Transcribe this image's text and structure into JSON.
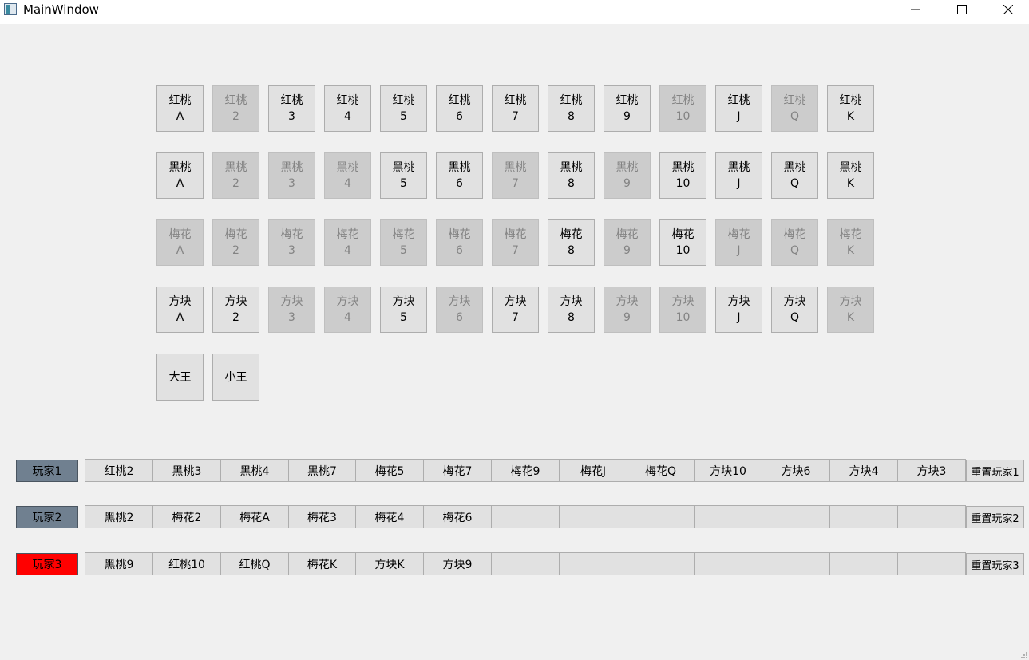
{
  "window": {
    "title": "MainWindow"
  },
  "deck": {
    "rows": [
      {
        "suit": "红桃",
        "cards": [
          {
            "rank": "A",
            "disabled": false
          },
          {
            "rank": "2",
            "disabled": true
          },
          {
            "rank": "3",
            "disabled": false
          },
          {
            "rank": "4",
            "disabled": false
          },
          {
            "rank": "5",
            "disabled": false
          },
          {
            "rank": "6",
            "disabled": false
          },
          {
            "rank": "7",
            "disabled": false
          },
          {
            "rank": "8",
            "disabled": false
          },
          {
            "rank": "9",
            "disabled": false
          },
          {
            "rank": "10",
            "disabled": true
          },
          {
            "rank": "J",
            "disabled": false
          },
          {
            "rank": "Q",
            "disabled": true
          },
          {
            "rank": "K",
            "disabled": false
          }
        ]
      },
      {
        "suit": "黑桃",
        "cards": [
          {
            "rank": "A",
            "disabled": false
          },
          {
            "rank": "2",
            "disabled": true
          },
          {
            "rank": "3",
            "disabled": true
          },
          {
            "rank": "4",
            "disabled": true
          },
          {
            "rank": "5",
            "disabled": false
          },
          {
            "rank": "6",
            "disabled": false
          },
          {
            "rank": "7",
            "disabled": true
          },
          {
            "rank": "8",
            "disabled": false
          },
          {
            "rank": "9",
            "disabled": true
          },
          {
            "rank": "10",
            "disabled": false
          },
          {
            "rank": "J",
            "disabled": false
          },
          {
            "rank": "Q",
            "disabled": false
          },
          {
            "rank": "K",
            "disabled": false
          }
        ]
      },
      {
        "suit": "梅花",
        "cards": [
          {
            "rank": "A",
            "disabled": true
          },
          {
            "rank": "2",
            "disabled": true
          },
          {
            "rank": "3",
            "disabled": true
          },
          {
            "rank": "4",
            "disabled": true
          },
          {
            "rank": "5",
            "disabled": true
          },
          {
            "rank": "6",
            "disabled": true
          },
          {
            "rank": "7",
            "disabled": true
          },
          {
            "rank": "8",
            "disabled": false
          },
          {
            "rank": "9",
            "disabled": true
          },
          {
            "rank": "10",
            "disabled": false
          },
          {
            "rank": "J",
            "disabled": true
          },
          {
            "rank": "Q",
            "disabled": true
          },
          {
            "rank": "K",
            "disabled": true
          }
        ]
      },
      {
        "suit": "方块",
        "cards": [
          {
            "rank": "A",
            "disabled": false
          },
          {
            "rank": "2",
            "disabled": false
          },
          {
            "rank": "3",
            "disabled": true
          },
          {
            "rank": "4",
            "disabled": true
          },
          {
            "rank": "5",
            "disabled": false
          },
          {
            "rank": "6",
            "disabled": true
          },
          {
            "rank": "7",
            "disabled": false
          },
          {
            "rank": "8",
            "disabled": false
          },
          {
            "rank": "9",
            "disabled": true
          },
          {
            "rank": "10",
            "disabled": true
          },
          {
            "rank": "J",
            "disabled": false
          },
          {
            "rank": "Q",
            "disabled": false
          },
          {
            "rank": "K",
            "disabled": true
          }
        ]
      }
    ],
    "jokers": [
      {
        "label": "大王",
        "disabled": false
      },
      {
        "label": "小王",
        "disabled": false
      }
    ]
  },
  "players": [
    {
      "label": "玩家1",
      "color": "#708090",
      "reset_label": "重置玩家1",
      "hand": [
        "红桃2",
        "黑桃3",
        "黑桃4",
        "黑桃7",
        "梅花5",
        "梅花7",
        "梅花9",
        "梅花J",
        "梅花Q",
        "方块10",
        "方块6",
        "方块4",
        "方块3"
      ]
    },
    {
      "label": "玩家2",
      "color": "#708090",
      "reset_label": "重置玩家2",
      "hand": [
        "黑桃2",
        "梅花2",
        "梅花A",
        "梅花3",
        "梅花4",
        "梅花6",
        "",
        "",
        "",
        "",
        "",
        "",
        ""
      ]
    },
    {
      "label": "玩家3",
      "color": "#ff0000",
      "reset_label": "重置玩家3",
      "hand": [
        "黑桃9",
        "红桃10",
        "红桃Q",
        "梅花K",
        "方块K",
        "方块9",
        "",
        "",
        "",
        "",
        "",
        "",
        ""
      ]
    }
  ],
  "colors": {
    "window_bg": "#f0f0f0",
    "titlebar_bg": "#ffffff",
    "card_enabled_bg": "#e1e1e1",
    "card_disabled_bg": "#cccccc",
    "card_disabled_text": "#838383"
  }
}
